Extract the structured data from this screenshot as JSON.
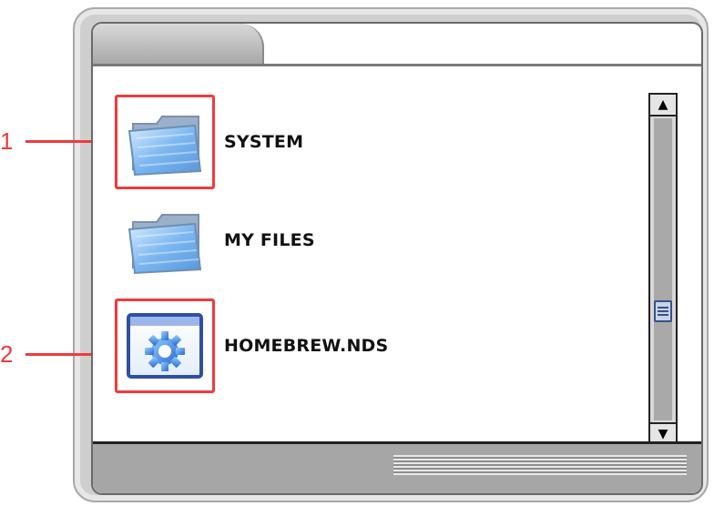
{
  "files": [
    {
      "name": "SYSTEM",
      "icon": "folder-icon",
      "highlighted": true,
      "callout": "1"
    },
    {
      "name": "MY FILES",
      "icon": "folder-icon",
      "highlighted": false,
      "callout": ""
    },
    {
      "name": "HOMEBREW.NDS",
      "icon": "gear-app-icon",
      "highlighted": true,
      "callout": "2"
    }
  ],
  "colors": {
    "highlight": "#f23a3a",
    "folder_blue": "#6aa6e8",
    "app_blue": "#2f63d4"
  }
}
